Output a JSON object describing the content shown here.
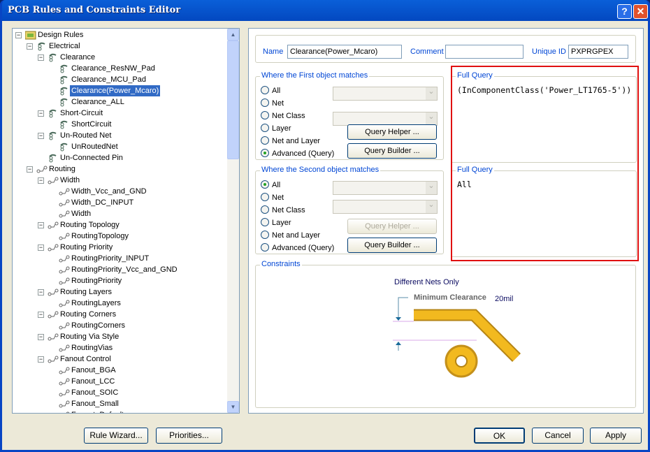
{
  "window": {
    "title": "PCB Rules and Constraints Editor",
    "help": "?",
    "close": "✕"
  },
  "tree": [
    {
      "label": "Design Rules",
      "level": 0,
      "exp": "-",
      "icon": "folder"
    },
    {
      "label": "Electrical",
      "level": 1,
      "exp": "-",
      "icon": "rule"
    },
    {
      "label": "Clearance",
      "level": 2,
      "exp": "-",
      "icon": "rule"
    },
    {
      "label": "Clearance_ResNW_Pad",
      "level": 3,
      "icon": "rule"
    },
    {
      "label": "Clearance_MCU_Pad",
      "level": 3,
      "icon": "rule"
    },
    {
      "label": "Clearance(Power_Mcaro)",
      "level": 3,
      "icon": "rule",
      "selected": true
    },
    {
      "label": "Clearance_ALL",
      "level": 3,
      "icon": "rule"
    },
    {
      "label": "Short-Circuit",
      "level": 2,
      "exp": "-",
      "icon": "rule"
    },
    {
      "label": "ShortCircuit",
      "level": 3,
      "icon": "rule"
    },
    {
      "label": "Un-Routed Net",
      "level": 2,
      "exp": "-",
      "icon": "rule"
    },
    {
      "label": "UnRoutedNet",
      "level": 3,
      "icon": "rule"
    },
    {
      "label": "Un-Connected Pin",
      "level": 2,
      "icon": "rule"
    },
    {
      "label": "Routing",
      "level": 1,
      "exp": "-",
      "icon": "route"
    },
    {
      "label": "Width",
      "level": 2,
      "exp": "-",
      "icon": "route"
    },
    {
      "label": "Width_Vcc_and_GND",
      "level": 3,
      "icon": "route"
    },
    {
      "label": "Width_DC_INPUT",
      "level": 3,
      "icon": "route"
    },
    {
      "label": "Width",
      "level": 3,
      "icon": "route"
    },
    {
      "label": "Routing Topology",
      "level": 2,
      "exp": "-",
      "icon": "route"
    },
    {
      "label": "RoutingTopology",
      "level": 3,
      "icon": "route"
    },
    {
      "label": "Routing Priority",
      "level": 2,
      "exp": "-",
      "icon": "route"
    },
    {
      "label": "RoutingPriority_INPUT",
      "level": 3,
      "icon": "route"
    },
    {
      "label": "RoutingPriority_Vcc_and_GND",
      "level": 3,
      "icon": "route"
    },
    {
      "label": "RoutingPriority",
      "level": 3,
      "icon": "route"
    },
    {
      "label": "Routing Layers",
      "level": 2,
      "exp": "-",
      "icon": "route"
    },
    {
      "label": "RoutingLayers",
      "level": 3,
      "icon": "route"
    },
    {
      "label": "Routing Corners",
      "level": 2,
      "exp": "-",
      "icon": "route"
    },
    {
      "label": "RoutingCorners",
      "level": 3,
      "icon": "route"
    },
    {
      "label": "Routing Via Style",
      "level": 2,
      "exp": "-",
      "icon": "route"
    },
    {
      "label": "RoutingVias",
      "level": 3,
      "icon": "route"
    },
    {
      "label": "Fanout Control",
      "level": 2,
      "exp": "-",
      "icon": "route"
    },
    {
      "label": "Fanout_BGA",
      "level": 3,
      "icon": "route"
    },
    {
      "label": "Fanout_LCC",
      "level": 3,
      "icon": "route"
    },
    {
      "label": "Fanout_SOIC",
      "level": 3,
      "icon": "route"
    },
    {
      "label": "Fanout_Small",
      "level": 3,
      "icon": "route"
    },
    {
      "label": "Fanout_Default",
      "level": 3,
      "icon": "route"
    }
  ],
  "header": {
    "name_label": "Name",
    "name_value": "Clearance(Power_Mcaro)",
    "comment_label": "Comment",
    "comment_value": "",
    "uid_label": "Unique ID",
    "uid_value": "PXPRGPEX"
  },
  "first": {
    "title": "Where the First object matches",
    "options": [
      "All",
      "Net",
      "Net Class",
      "Layer",
      "Net and Layer",
      "Advanced (Query)"
    ],
    "selected": 5,
    "helper": "Query Helper ...",
    "builder": "Query Builder ...",
    "query_title": "Full Query",
    "query": "(InComponentClass('Power_LT1765-5'))"
  },
  "second": {
    "title": "Where the Second object matches",
    "options": [
      "All",
      "Net",
      "Net Class",
      "Layer",
      "Net and Layer",
      "Advanced (Query)"
    ],
    "selected": 0,
    "helper": "Query Helper ...",
    "builder": "Query Builder ...",
    "query_title": "Full Query",
    "query": "All"
  },
  "constraints": {
    "title": "Constraints",
    "mode": "Different Nets Only",
    "min_label": "Minimum Clearance",
    "min_value": "20mil",
    "track_color": "#f2b91f"
  },
  "footer": {
    "wizard": "Rule Wizard...",
    "priorities": "Priorities...",
    "ok": "OK",
    "cancel": "Cancel",
    "apply": "Apply"
  }
}
